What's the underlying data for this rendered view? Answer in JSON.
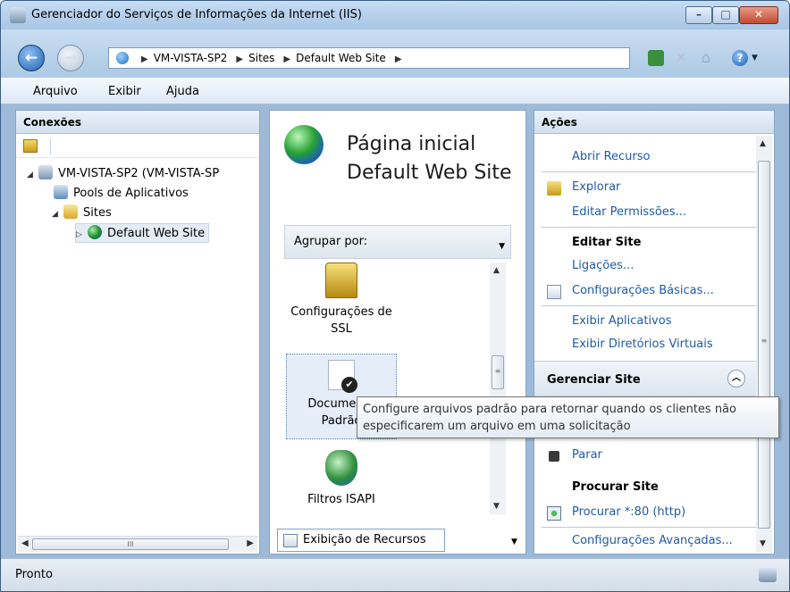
{
  "window": {
    "title": "Gerenciador do Serviços de Informações da Internet (IIS)",
    "controls": {
      "minimize": "–",
      "maximize": "□",
      "close": "✕"
    }
  },
  "nav": {
    "back_glyph": "←",
    "forward_glyph": "→",
    "breadcrumbs": [
      "VM-VISTA-SP2",
      "Sites",
      "Default Web Site"
    ],
    "breadcrumb_sep": "▶",
    "help_glyph": "?"
  },
  "menu": {
    "items": [
      "Arquivo",
      "Exibir",
      "Ajuda"
    ]
  },
  "connections": {
    "title": "Conexões",
    "tree": [
      {
        "label": "VM-VISTA-SP2 (VM-VISTA-SP",
        "exp": "◢"
      },
      {
        "label": "Pools de Aplicativos",
        "exp": ""
      },
      {
        "label": "Sites",
        "exp": "◢"
      },
      {
        "label": "Default Web Site",
        "exp": "▷"
      }
    ],
    "scroll_grip": "III"
  },
  "center": {
    "title": "Página inicial Default Web Site",
    "group_by_label": "Agrupar por:",
    "features": [
      {
        "label": "Configurações de SSL"
      },
      {
        "label": "Documento Padrão"
      },
      {
        "label": "Filtros ISAPI"
      }
    ],
    "view_button": "Exibição de Recursos"
  },
  "actions": {
    "title": "Ações",
    "items": {
      "abrir_recurso": "Abrir Recurso",
      "explorar": "Explorar",
      "editar_permissoes": "Editar Permissões...",
      "editar_site": "Editar Site",
      "ligacoes": "Ligações...",
      "config_basicas": "Configurações Básicas...",
      "exibir_aplicativos": "Exibir Aplicativos",
      "exibir_diretorios": "Exibir Diretórios Virtuais",
      "gerenciar_site": "Gerenciar Site",
      "parar": "Parar",
      "procurar_site": "Procurar Site",
      "procurar_80": "Procurar *:80 (http)",
      "config_avancadas": "Configurações Avançadas..."
    }
  },
  "tooltip": {
    "text": "Configure arquivos padrão para retornar quando os clientes não especificarem um arquivo em uma solicitação"
  },
  "status": {
    "text": "Pronto"
  }
}
